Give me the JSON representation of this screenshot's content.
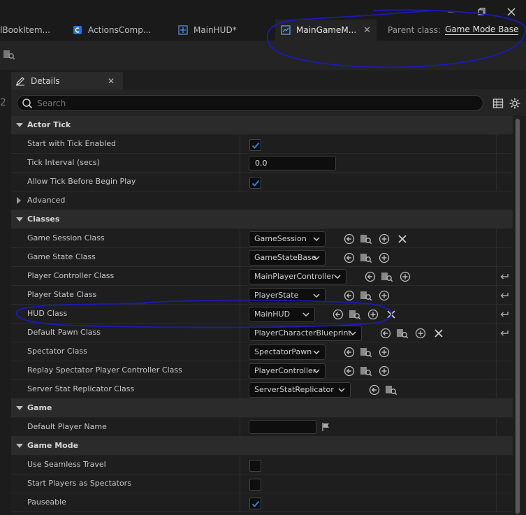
{
  "tabs": [
    {
      "label": "lBookItem...",
      "icon": "blueprint-icon"
    },
    {
      "label": "ActionsComp...",
      "icon": "component-icon"
    },
    {
      "label": "MainHUD*",
      "icon": "widget-icon"
    },
    {
      "label": "MainGameM...",
      "icon": "blueprint-icon",
      "active": true
    }
  ],
  "parent_class": {
    "label": "Parent class:",
    "value": "Game Mode Base"
  },
  "panel": {
    "title": "Details",
    "search_placeholder": "Search"
  },
  "sections": {
    "actor_tick": "Actor Tick",
    "advanced": "Advanced",
    "classes": "Classes",
    "game": "Game",
    "game_mode": "Game Mode"
  },
  "actor_tick": {
    "start_with_tick": {
      "label": "Start with Tick Enabled",
      "checked": true
    },
    "tick_interval": {
      "label": "Tick Interval (secs)",
      "value": "0.0"
    },
    "allow_tick": {
      "label": "Allow Tick Before Begin Play",
      "checked": true
    }
  },
  "classes": [
    {
      "label": "Game Session Class",
      "value": "GameSession"
    },
    {
      "label": "Game State Class",
      "value": "GameStateBase"
    },
    {
      "label": "Player Controller Class",
      "value": "MainPlayerController"
    },
    {
      "label": "Player State Class",
      "value": "PlayerState"
    },
    {
      "label": "HUD Class",
      "value": "MainHUD"
    },
    {
      "label": "Default Pawn Class",
      "value": "PlayerCharacterBlueprint"
    },
    {
      "label": "Spectator Class",
      "value": "SpectatorPawn"
    },
    {
      "label": "Replay Spectator Player Controller Class",
      "value": "PlayerController"
    },
    {
      "label": "Server Stat Replicator Class",
      "value": "ServerStatReplicator"
    }
  ],
  "game": {
    "default_player_name": {
      "label": "Default Player Name",
      "value": ""
    }
  },
  "game_mode": {
    "seamless_travel": {
      "label": "Use Seamless Travel",
      "checked": false
    },
    "start_spectators": {
      "label": "Start Players as Spectators",
      "checked": false
    },
    "pauseable": {
      "label": "Pauseable",
      "checked": true
    }
  },
  "colors": {
    "accent": "#2a7fdb",
    "annotation": "#1a1ab8",
    "background": "#1e1e1e"
  }
}
